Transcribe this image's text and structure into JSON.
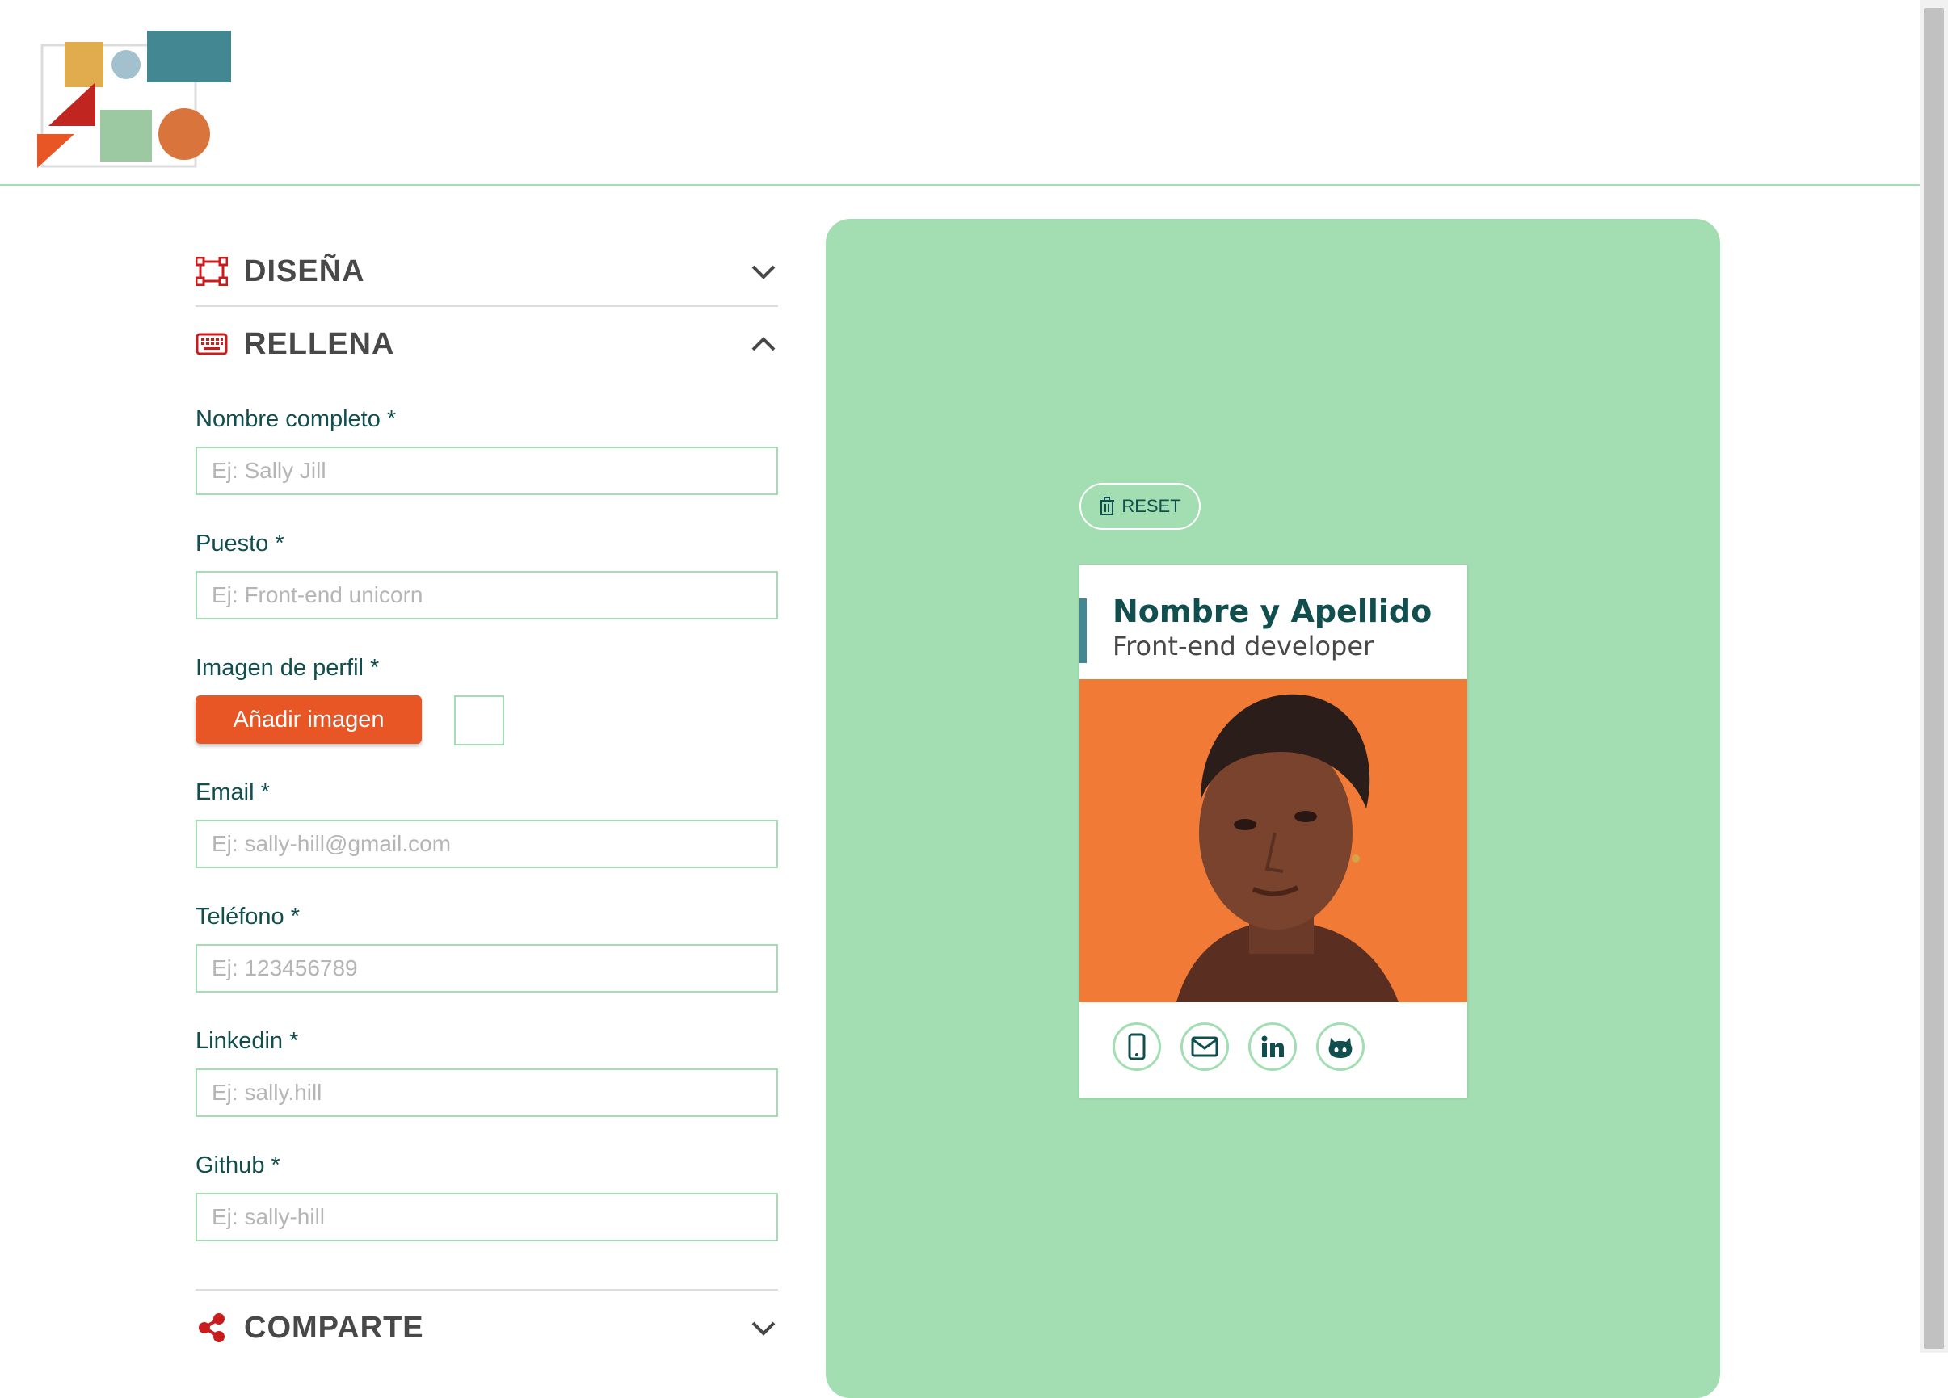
{
  "sections": {
    "design": {
      "title": "DISEÑA",
      "icon": "design-frame-icon",
      "state": "collapsed"
    },
    "fill": {
      "title": "RELLENA",
      "icon": "keyboard-icon",
      "state": "expanded"
    },
    "share": {
      "title": "COMPARTE",
      "icon": "share-icon",
      "state": "collapsed"
    }
  },
  "form": {
    "name": {
      "label": "Nombre completo *",
      "placeholder": "Ej: Sally Jill",
      "value": ""
    },
    "job": {
      "label": "Puesto *",
      "placeholder": "Ej: Front-end unicorn",
      "value": ""
    },
    "image": {
      "label": "Imagen de perfil *",
      "button": "Añadir imagen"
    },
    "email": {
      "label": "Email *",
      "placeholder": "Ej: sally-hill@gmail.com",
      "value": ""
    },
    "phone": {
      "label": "Teléfono *",
      "placeholder": "Ej: 123456789",
      "value": ""
    },
    "linkedin": {
      "label": "Linkedin *",
      "placeholder": "Ej: sally.hill",
      "value": ""
    },
    "github": {
      "label": "Github *",
      "placeholder": "Ej: sally-hill",
      "value": ""
    }
  },
  "preview": {
    "reset_label": "RESET",
    "card": {
      "name": "Nombre y Apellido",
      "job": "Front-end developer",
      "social_icons": [
        "mobile-phone-icon",
        "envelope-icon",
        "linkedin-icon",
        "github-icon"
      ]
    }
  },
  "colors": {
    "accent_green": "#a2deb2",
    "primary_text": "#114e4e",
    "button_orange": "#e95626",
    "section_icon_red": "#c91d1d",
    "card_bar": "#438792"
  }
}
